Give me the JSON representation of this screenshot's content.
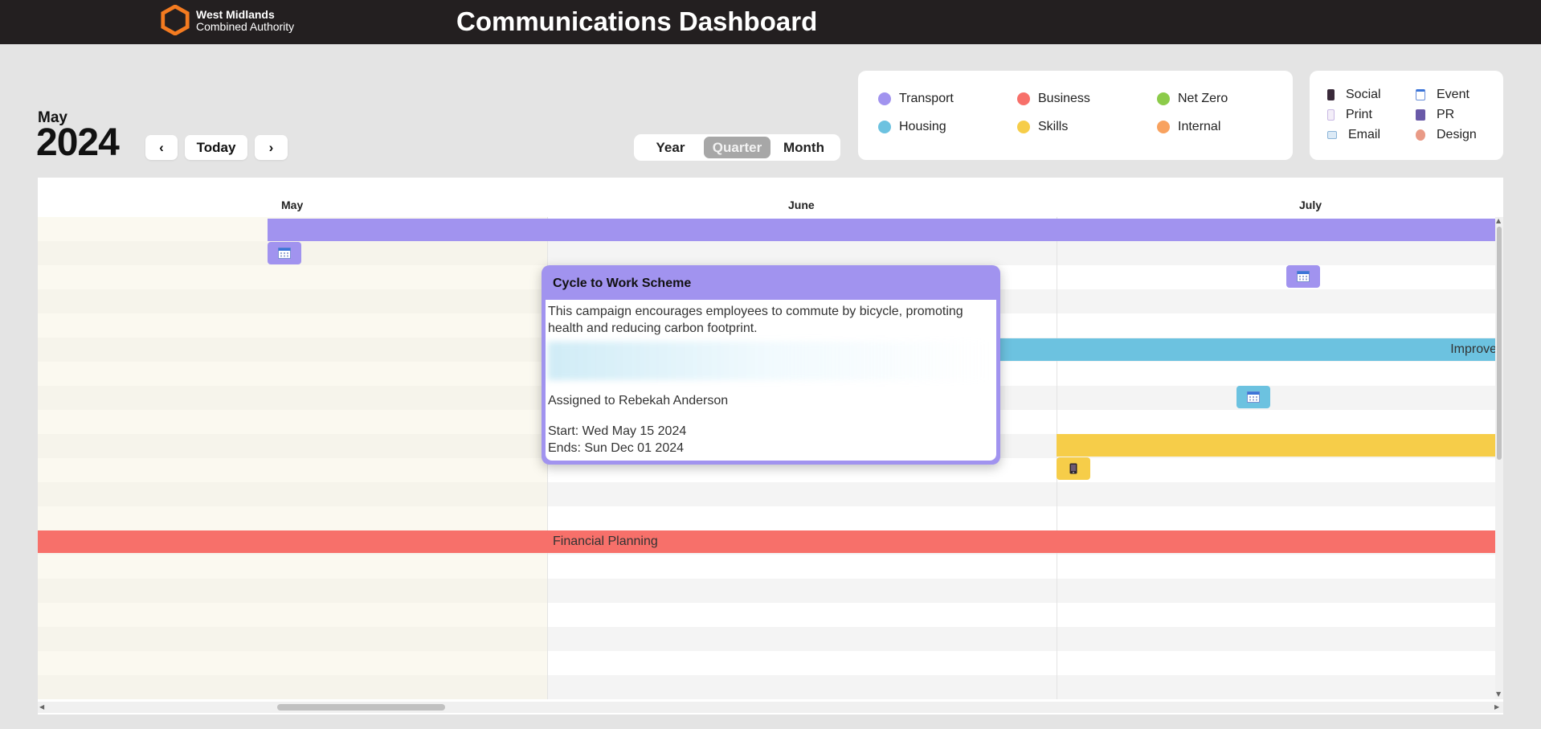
{
  "header": {
    "org_line1": "West Midlands",
    "org_line2": "Combined Authority",
    "title": "Communications Dashboard",
    "brand_color": "#f47b20"
  },
  "date": {
    "month": "May",
    "year": "2024"
  },
  "nav": {
    "prev": "‹",
    "today": "Today",
    "next": "›"
  },
  "views": {
    "options": [
      "Year",
      "Quarter",
      "Month"
    ],
    "selected": "Quarter"
  },
  "themes": [
    {
      "label": "Transport",
      "color": "#a193ef"
    },
    {
      "label": "Business",
      "color": "#f7706a"
    },
    {
      "label": "Net Zero",
      "color": "#8ccb4a"
    },
    {
      "label": "Housing",
      "color": "#6cc2e0"
    },
    {
      "label": "Skills",
      "color": "#f6cd49"
    },
    {
      "label": "Internal",
      "color": "#f8a25f"
    }
  ],
  "types": [
    {
      "label": "Social",
      "icon": "phone-icon"
    },
    {
      "label": "Event",
      "icon": "calendar-icon"
    },
    {
      "label": "Print",
      "icon": "document-icon"
    },
    {
      "label": "PR",
      "icon": "megaphone-icon"
    },
    {
      "label": "Email",
      "icon": "envelope-icon"
    },
    {
      "label": "Design",
      "icon": "palette-icon"
    }
  ],
  "calendar": {
    "months": [
      "May",
      "June",
      "July"
    ],
    "bars": {
      "housing_label": "Improve",
      "business_label": "Financial Planning"
    }
  },
  "popup": {
    "title": "Cycle to Work Scheme",
    "description": "This campaign encourages employees to commute by bicycle, promoting health and reducing carbon footprint.",
    "assigned": "Assigned to Rebekah Anderson",
    "start": "Start: Wed May 15 2024",
    "end": "Ends: Sun Dec 01 2024"
  }
}
